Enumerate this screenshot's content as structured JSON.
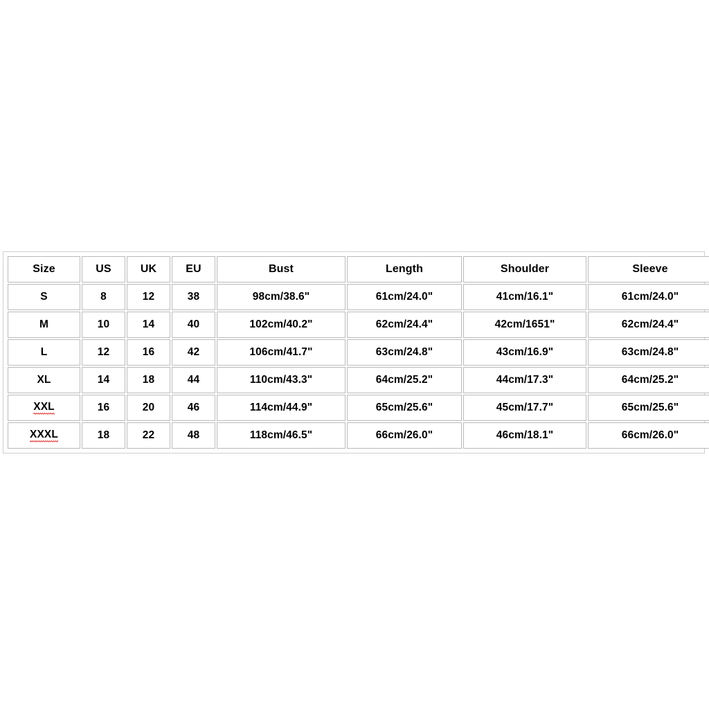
{
  "table": {
    "columns": [
      "Size",
      "US",
      "UK",
      "EU",
      "Bust",
      "Length",
      "Shoulder",
      "Sleeve"
    ],
    "rows": [
      {
        "size": "S",
        "size_misspelled": false,
        "us": "8",
        "uk": "12",
        "eu": "38",
        "bust": "98cm/38.6\"",
        "length": "61cm/24.0\"",
        "shoulder": "41cm/16.1\"",
        "sleeve": "61cm/24.0\""
      },
      {
        "size": "M",
        "size_misspelled": false,
        "us": "10",
        "uk": "14",
        "eu": "40",
        "bust": "102cm/40.2\"",
        "length": "62cm/24.4\"",
        "shoulder": "42cm/1651\"",
        "sleeve": "62cm/24.4\""
      },
      {
        "size": "L",
        "size_misspelled": false,
        "us": "12",
        "uk": "16",
        "eu": "42",
        "bust": "106cm/41.7\"",
        "length": "63cm/24.8\"",
        "shoulder": "43cm/16.9\"",
        "sleeve": "63cm/24.8\""
      },
      {
        "size": "XL",
        "size_misspelled": false,
        "us": "14",
        "uk": "18",
        "eu": "44",
        "bust": "110cm/43.3\"",
        "length": "64cm/25.2\"",
        "shoulder": "44cm/17.3\"",
        "sleeve": "64cm/25.2\""
      },
      {
        "size": "XXL",
        "size_misspelled": true,
        "us": "16",
        "uk": "20",
        "eu": "46",
        "bust": "114cm/44.9\"",
        "length": "65cm/25.6\"",
        "shoulder": "45cm/17.7\"",
        "sleeve": "65cm/25.6\""
      },
      {
        "size": "XXXL",
        "size_misspelled": true,
        "us": "18",
        "uk": "22",
        "eu": "48",
        "bust": "118cm/46.5\"",
        "length": "66cm/26.0\"",
        "shoulder": "46cm/18.1\"",
        "sleeve": "66cm/26.0\""
      }
    ]
  },
  "colors": {
    "background": "#ffffff",
    "text": "#000000",
    "cell_border": "#b9b9b9",
    "outer_border": "#cfcfcf",
    "spellcheck_underline": "#e02424"
  }
}
